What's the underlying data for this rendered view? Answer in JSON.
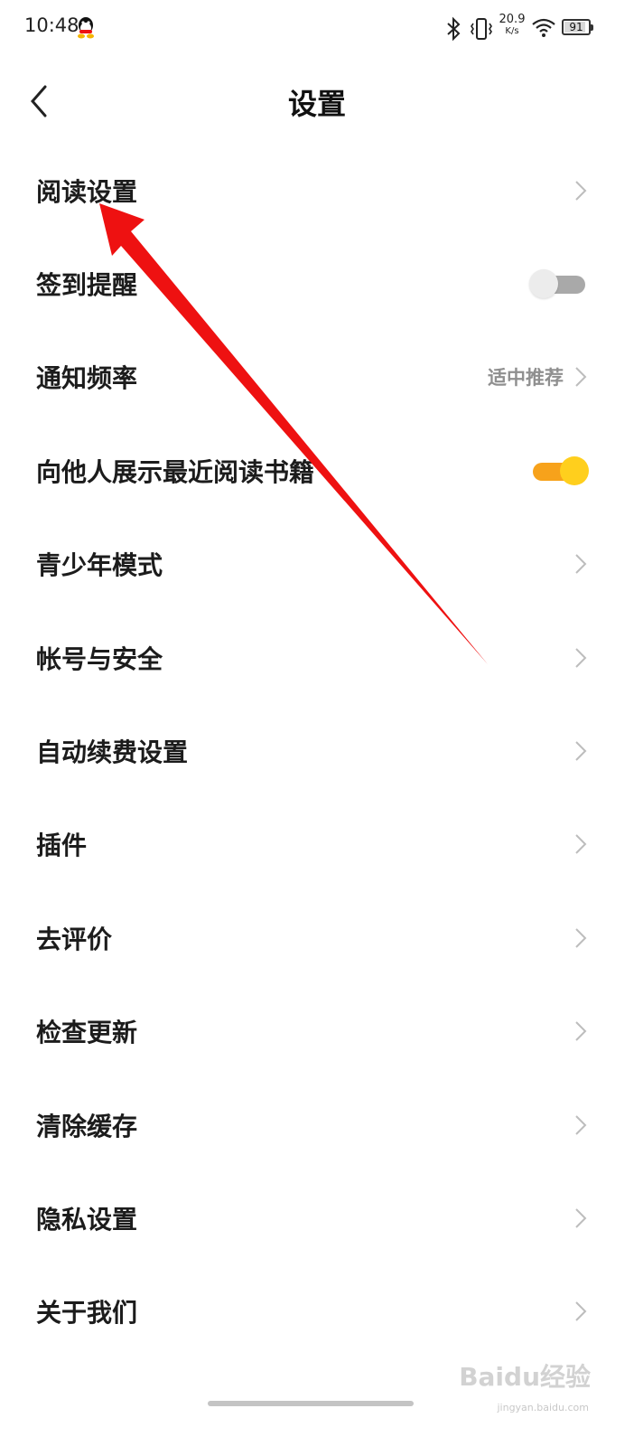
{
  "status_bar": {
    "time": "10:48",
    "net_speed_value": "20.9",
    "net_speed_unit": "K/s",
    "battery_level": "91",
    "icons": [
      "qq-icon",
      "bluetooth-icon",
      "vibrate-icon",
      "wifi-icon",
      "battery-icon"
    ]
  },
  "header": {
    "title": "设置",
    "back_icon": "back-chevron-icon"
  },
  "settings": {
    "items": [
      {
        "label": "阅读设置",
        "control": "chevron"
      },
      {
        "label": "签到提醒",
        "control": "toggle",
        "state": "off"
      },
      {
        "label": "通知频率",
        "control": "chevron",
        "value": "适中推荐"
      },
      {
        "label": "向他人展示最近阅读书籍",
        "control": "toggle",
        "state": "on"
      },
      {
        "label": "青少年模式",
        "control": "chevron"
      },
      {
        "label": "帐号与安全",
        "control": "chevron"
      },
      {
        "label": "自动续费设置",
        "control": "chevron"
      },
      {
        "label": "插件",
        "control": "chevron"
      },
      {
        "label": "去评价",
        "control": "chevron"
      },
      {
        "label": "检查更新",
        "control": "chevron"
      },
      {
        "label": "清除缓存",
        "control": "chevron"
      },
      {
        "label": "隐私设置",
        "control": "chevron"
      },
      {
        "label": "关于我们",
        "control": "chevron"
      }
    ]
  },
  "colors": {
    "toggle_on_track": "#f7a21b",
    "toggle_on_knob": "#ffcf1d",
    "toggle_off_track": "#a9a9a9",
    "annotation_arrow": "#ee1111"
  },
  "watermark": {
    "text": "Baidu经验",
    "sub": "jingyan.baidu.com"
  }
}
